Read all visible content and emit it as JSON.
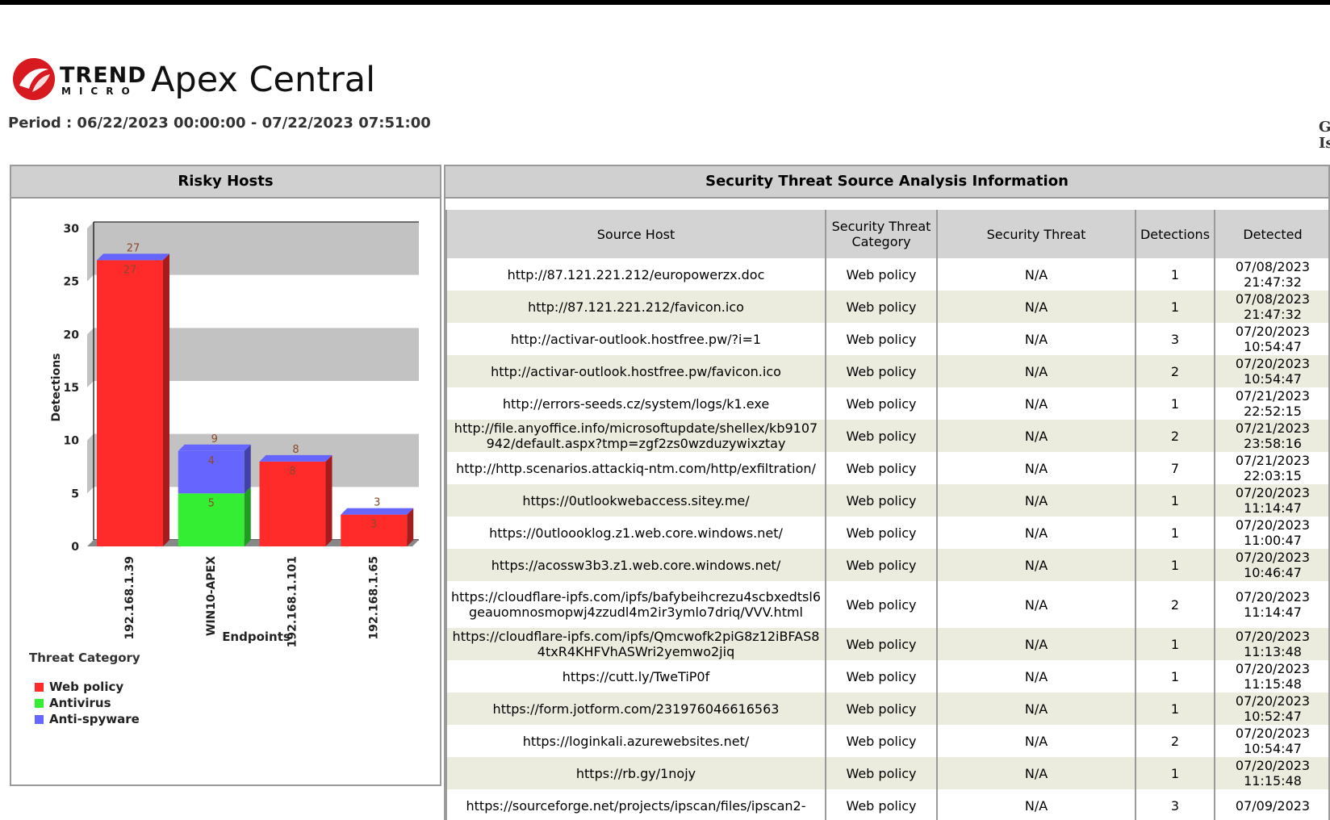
{
  "app": {
    "brand_top": "TREND",
    "brand_bottom": "MICRO",
    "product": "Apex Central",
    "period": "Period : 06/22/2023 00:00:00 - 07/22/2023 07:51:00",
    "edge_text_line1": "G",
    "edge_text_line2": "Is"
  },
  "risky_panel": {
    "title": "Risky Hosts"
  },
  "chart_data": {
    "type": "bar",
    "stacked": true,
    "ylabel": "Detections",
    "xlabel": "Endpoints",
    "ylim": [
      0,
      30
    ],
    "yticks": [
      0,
      5,
      10,
      15,
      20,
      25,
      30
    ],
    "categories": [
      "192.168.1.39",
      "WIN10-APEX",
      "192.168.1.101",
      "192.168.1.65"
    ],
    "series": [
      {
        "name": "Web policy",
        "color": "#ff2b2b",
        "values": [
          27,
          0,
          8,
          3
        ]
      },
      {
        "name": "Antivirus",
        "color": "#33ee33",
        "values": [
          0,
          5,
          0,
          0
        ]
      },
      {
        "name": "Anti-spyware",
        "color": "#6666ff",
        "values": [
          0,
          4,
          0,
          0
        ]
      }
    ],
    "totals": [
      27,
      9,
      8,
      3
    ],
    "legend_title": "Threat Category",
    "legend_position": "bottom-left",
    "grid_bands": true
  },
  "threat_panel": {
    "title": "Security Threat Source Analysis Information",
    "columns": [
      "Source Host",
      "Security Threat Category",
      "Security Threat",
      "Detections",
      "Detected"
    ],
    "rows": [
      {
        "host": "http://87.121.221.212/europowerzx.doc",
        "category": "Web policy",
        "threat": "N/A",
        "detections": "1",
        "date": "07/08/2023",
        "time": "21:47:32"
      },
      {
        "host": "http://87.121.221.212/favicon.ico",
        "category": "Web policy",
        "threat": "N/A",
        "detections": "1",
        "date": "07/08/2023",
        "time": "21:47:32"
      },
      {
        "host": "http://activar-outlook.hostfree.pw/?i=1",
        "category": "Web policy",
        "threat": "N/A",
        "detections": "3",
        "date": "07/20/2023",
        "time": "10:54:47"
      },
      {
        "host": "http://activar-outlook.hostfree.pw/favicon.ico",
        "category": "Web policy",
        "threat": "N/A",
        "detections": "2",
        "date": "07/20/2023",
        "time": "10:54:47"
      },
      {
        "host": "http://errors-seeds.cz/system/logs/k1.exe",
        "category": "Web policy",
        "threat": "N/A",
        "detections": "1",
        "date": "07/21/2023",
        "time": "22:52:15"
      },
      {
        "host": "http://file.anyoffice.info/microsoftupdate/shellex/kb9107942/default.aspx?tmp=zgf2zs0wzduzywixztay",
        "category": "Web policy",
        "threat": "N/A",
        "detections": "2",
        "date": "07/21/2023",
        "time": "23:58:16"
      },
      {
        "host": "http://http.scenarios.attackiq-ntm.com/http/exfiltration/",
        "category": "Web policy",
        "threat": "N/A",
        "detections": "7",
        "date": "07/21/2023",
        "time": "22:03:15"
      },
      {
        "host": "https://0utlookwebaccess.sitey.me/",
        "category": "Web policy",
        "threat": "N/A",
        "detections": "1",
        "date": "07/20/2023",
        "time": "11:14:47"
      },
      {
        "host": "https://0utloooklog.z1.web.core.windows.net/",
        "category": "Web policy",
        "threat": "N/A",
        "detections": "1",
        "date": "07/20/2023",
        "time": "11:00:47"
      },
      {
        "host": "https://acossw3b3.z1.web.core.windows.net/",
        "category": "Web policy",
        "threat": "N/A",
        "detections": "1",
        "date": "07/20/2023",
        "time": "10:46:47"
      },
      {
        "host": "https://cloudflare-ipfs.com/ipfs/bafybeihcrezu4scbxedtsl6geauomnosmopwj4zzudl4m2ir3ymlo7driq/VVV.html",
        "category": "Web policy",
        "threat": "N/A",
        "detections": "2",
        "date": "07/20/2023",
        "time": "11:14:47",
        "tall": true
      },
      {
        "host": "https://cloudflare-ipfs.com/ipfs/Qmcwofk2piG8z12iBFAS84txR4KHFVhASWri2yemwo2jiq",
        "category": "Web policy",
        "threat": "N/A",
        "detections": "1",
        "date": "07/20/2023",
        "time": "11:13:48"
      },
      {
        "host": "https://cutt.ly/TweTiP0f",
        "category": "Web policy",
        "threat": "N/A",
        "detections": "1",
        "date": "07/20/2023",
        "time": "11:15:48"
      },
      {
        "host": "https://form.jotform.com/231976046616563",
        "category": "Web policy",
        "threat": "N/A",
        "detections": "1",
        "date": "07/20/2023",
        "time": "10:52:47"
      },
      {
        "host": "https://loginkali.azurewebsites.net/",
        "category": "Web policy",
        "threat": "N/A",
        "detections": "2",
        "date": "07/20/2023",
        "time": "10:54:47"
      },
      {
        "host": "https://rb.gy/1nojy",
        "category": "Web policy",
        "threat": "N/A",
        "detections": "1",
        "date": "07/20/2023",
        "time": "11:15:48"
      },
      {
        "host": "https://sourceforge.net/projects/ipscan/files/ipscan2-",
        "category": "Web policy",
        "threat": "N/A",
        "detections": "3",
        "date": "07/09/2023",
        "time": ""
      }
    ]
  }
}
